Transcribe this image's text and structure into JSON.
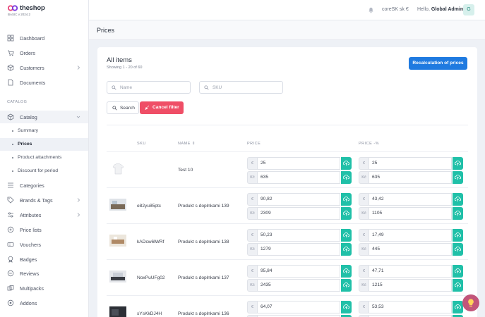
{
  "brand": {
    "name": "theshop",
    "sub": "BASIC v 2024.2"
  },
  "sidebar": {
    "items": [
      {
        "label": "Dashboard",
        "icon": "dashboard-icon"
      },
      {
        "label": "Orders",
        "icon": "cart-icon"
      },
      {
        "label": "Customers",
        "icon": "box-icon"
      },
      {
        "label": "Documents",
        "icon": "document-icon"
      }
    ],
    "section": "CATALOG",
    "catalog": {
      "label": "Catalog",
      "icon": "box-icon"
    },
    "catalog_sub": [
      {
        "label": "Summary"
      },
      {
        "label": "Prices"
      },
      {
        "label": "Product attachments"
      },
      {
        "label": "Discount for period"
      }
    ],
    "more": [
      {
        "label": "Categories",
        "icon": "list-icon"
      },
      {
        "label": "Brands & Tags",
        "icon": "tag-icon"
      },
      {
        "label": "Attributes",
        "icon": "attribute-icon"
      },
      {
        "label": "Price lists",
        "icon": "pricelist-icon"
      },
      {
        "label": "Vouchers",
        "icon": "voucher-icon"
      },
      {
        "label": "Badges",
        "icon": "badge-icon"
      },
      {
        "label": "Reviews",
        "icon": "review-icon"
      },
      {
        "label": "Multipacks",
        "icon": "multipack-icon"
      },
      {
        "label": "Addons",
        "icon": "addon-icon"
      }
    ]
  },
  "topbar": {
    "store": "coreSK  sk  €",
    "hello": "Hello,",
    "user": "Global Admin",
    "avatar": "G"
  },
  "page": {
    "title": "Prices"
  },
  "card": {
    "title": "All items",
    "subtitle": "Showing 1 - 20 of 60",
    "recalc_label": "Recalculation of prices",
    "name_placeholder": "Name",
    "sku_placeholder": "SKU",
    "search_label": "Search",
    "cancel_label": "Cancel filter"
  },
  "table": {
    "headers": {
      "sku": "SKU",
      "name": "NAME",
      "price": "PRICE",
      "price_vat": "PRICE -%"
    },
    "rows": [
      {
        "sku": "",
        "name": "Test 10",
        "price_eur": "25",
        "price_czk": "635",
        "vat_eur": "25",
        "vat_czk": "635"
      },
      {
        "sku": "e82yu85ptc",
        "name": "Produkt s doplnkami 139",
        "price_eur": "90,82",
        "price_czk": "2309",
        "vat_eur": "43,42",
        "vat_czk": "1105"
      },
      {
        "sku": "kADcw6lWRf",
        "name": "Produkt s doplnkami 138",
        "price_eur": "50,23",
        "price_czk": "1279",
        "vat_eur": "17,49",
        "vat_czk": "445"
      },
      {
        "sku": "NoxPuUFg02",
        "name": "Produkt s doplnkami 137",
        "price_eur": "95,84",
        "price_czk": "2435",
        "vat_eur": "47,71",
        "vat_czk": "1215"
      },
      {
        "sku": "sYsKkDJ4H",
        "name": "Produkt s doplnkami 136",
        "price_eur": "64,07",
        "price_czk": "",
        "vat_eur": "53,53",
        "vat_czk": ""
      }
    ],
    "currency_eur": "€",
    "currency_czk": "Kč"
  },
  "colors": {
    "accent": "#1f7ae0",
    "danger": "#ef4e66",
    "teal": "#20c0a8",
    "fab": "#c2557a"
  }
}
